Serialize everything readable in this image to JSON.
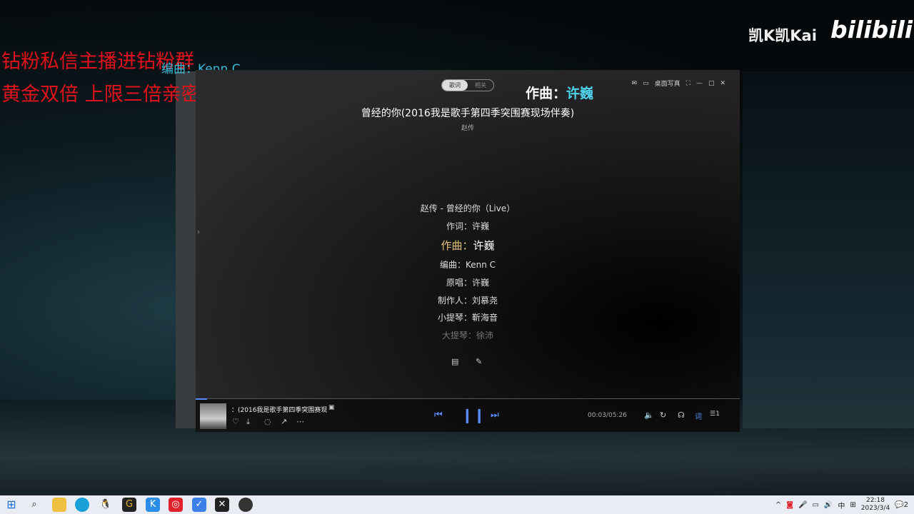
{
  "overlay": {
    "red_line1": "钻粉私信主播进钻粉群",
    "red_line2": "黄金双倍 上限三倍亲密度",
    "stray_lyric": "编曲：Kenn C",
    "float_label": "作曲：",
    "float_name": "许巍",
    "channel": "凯K凯Kai",
    "bilibili": "bilibili"
  },
  "player": {
    "tabs": [
      "歌词",
      "相关"
    ],
    "topbar": {
      "desktop_lyrics": "桌面写真"
    },
    "song_title": "曾经的你(2016我是歌手第四季突围赛现场伴奏)",
    "artist": "赵传",
    "lyrics": [
      {
        "label": "赵传 - 曾经的你（Live）"
      },
      {
        "label": "作词：",
        "value": "许巍"
      },
      {
        "label": "作曲：",
        "value": "许巍"
      },
      {
        "label": "编曲：",
        "value": "Kenn C"
      },
      {
        "label": "原唱：",
        "value": "许巍"
      },
      {
        "label": "制作人：",
        "value": "刘慕尧"
      },
      {
        "label": "小提琴：",
        "value": "靳海音"
      },
      {
        "label": "大提琴：",
        "value": "徐沛"
      }
    ],
    "now_playing": "：(2016我是歌手第四季突围赛现",
    "time": "00:03/05:26",
    "progress": 0.01,
    "lyric_btn": "词",
    "queue_count": "1"
  },
  "taskbar": {
    "time": "22:18",
    "date": "2023/3/4",
    "ime": "中",
    "notif": "2"
  }
}
